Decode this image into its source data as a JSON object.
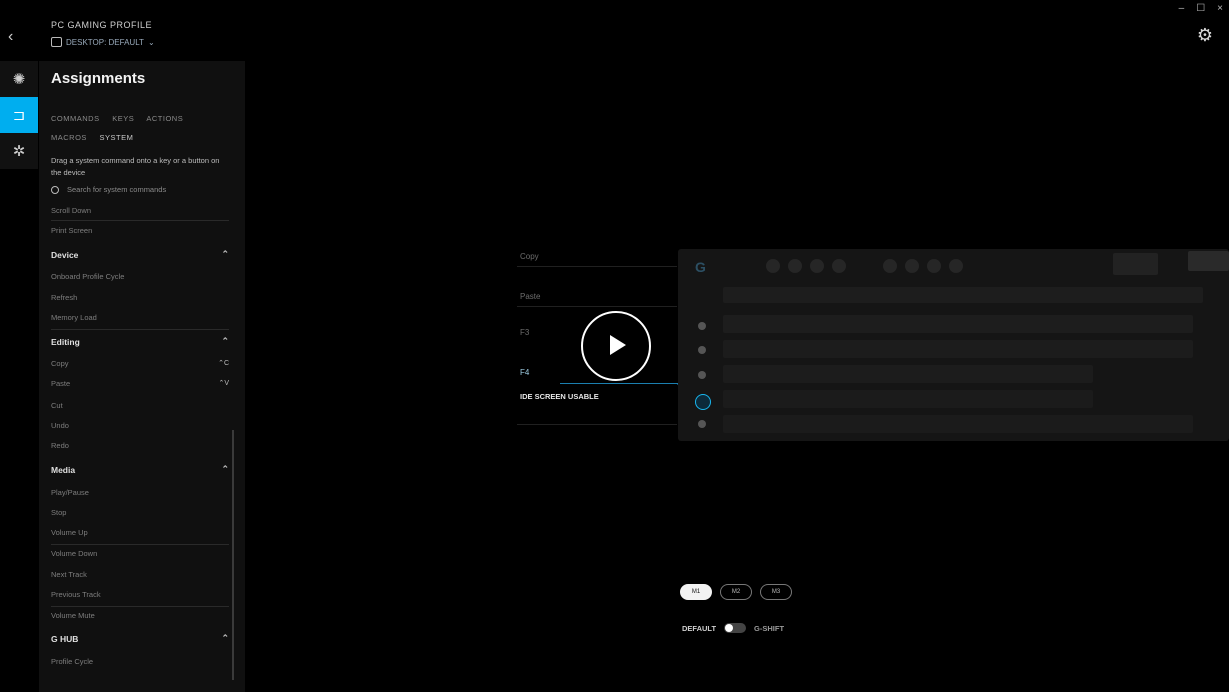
{
  "header": {
    "profile_title": "PC GAMING PROFILE",
    "profile_sub": "DESKTOP: DEFAULT"
  },
  "window": {
    "minimize": "–",
    "maximize": "☐",
    "close": "×"
  },
  "panel": {
    "title": "Assignments",
    "tabs": [
      "COMMANDS",
      "KEYS",
      "ACTIONS",
      "MACROS",
      "SYSTEM"
    ],
    "selected_tab": "SYSTEM",
    "description": "Drag a system command onto a key or a button on the device",
    "search_placeholder": "Search for system commands",
    "top_items": [
      "Scroll Down",
      "Print Screen"
    ],
    "sections": [
      {
        "title": "Device",
        "items": [
          "Onboard Profile Cycle",
          "Refresh",
          "Memory Load"
        ]
      },
      {
        "title": "Editing",
        "items": [
          {
            "label": "Copy",
            "key": "⌃C"
          },
          {
            "label": "Paste",
            "key": "⌃V"
          },
          {
            "label": "Cut",
            "key": ""
          },
          {
            "label": "Undo",
            "key": ""
          },
          {
            "label": "Redo",
            "key": ""
          }
        ]
      },
      {
        "title": "Media",
        "items": [
          "Play/Pause",
          "Stop",
          "Volume Up",
          "Volume Down",
          "Next Track",
          "Previous Track",
          "Volume Mute"
        ]
      },
      {
        "title": "G HUB",
        "items": [
          "Profile Cycle"
        ]
      }
    ]
  },
  "keyboard": {
    "labels": [
      "Copy",
      "Paste",
      "F3",
      "F4"
    ],
    "selected": "IDE SCREEN USABLE"
  },
  "modes": [
    "M1",
    "M2",
    "M3"
  ],
  "mode_selected": "M1",
  "toggle": {
    "left": "DEFAULT",
    "right": "G-SHIFT"
  },
  "colors": {
    "accent": "#00aeef"
  }
}
